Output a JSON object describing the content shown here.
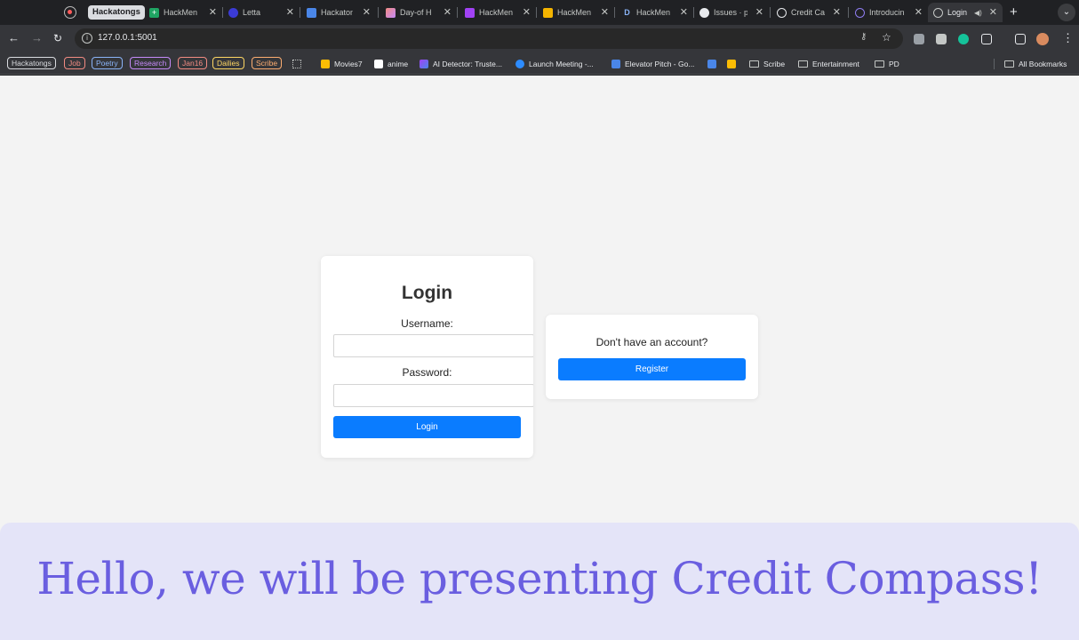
{
  "tabs": {
    "group_label": "Hackatongs",
    "items": [
      {
        "label": "HackMen",
        "icon": "sheets-icon"
      },
      {
        "label": "Letta",
        "icon": "letta-icon"
      },
      {
        "label": "Hackaton",
        "icon": "docs-icon"
      },
      {
        "label": "Day-of H",
        "icon": "wand-icon"
      },
      {
        "label": "HackMen",
        "icon": "hackmen-icon"
      },
      {
        "label": "HackMen",
        "icon": "slides-icon"
      },
      {
        "label": "HackMen",
        "icon": "d-icon"
      },
      {
        "label": "Issues · p",
        "icon": "github-icon"
      },
      {
        "label": "Credit Ca",
        "icon": "openai-icon"
      },
      {
        "label": "Introducin",
        "icon": "react-icon"
      },
      {
        "label": "Login",
        "icon": "globe-icon"
      }
    ]
  },
  "toolbar": {
    "url": "127.0.0.1:5001"
  },
  "bookmarks": {
    "chips": [
      {
        "label": "Hackatongs",
        "color": "#dadce0"
      },
      {
        "label": "Job",
        "color": "#f28b82"
      },
      {
        "label": "Poetry",
        "color": "#8ab4f8"
      },
      {
        "label": "Research",
        "color": "#c58af9"
      },
      {
        "label": "Jan16",
        "color": "#f28b82"
      },
      {
        "label": "Dailies",
        "color": "#fdd663"
      },
      {
        "label": "Scribe",
        "color": "#fcad70"
      }
    ],
    "items": [
      {
        "label": "Movies7",
        "icon": "play-icon"
      },
      {
        "label": "anime",
        "icon": "page-icon"
      },
      {
        "label": "AI Detector: Truste...",
        "icon": "ai-detector-icon"
      },
      {
        "label": "Launch Meeting -...",
        "icon": "zoom-icon"
      },
      {
        "label": "Elevator Pitch - Go...",
        "icon": "docs-icon"
      }
    ],
    "folders": [
      "Scribe",
      "Entertainment",
      "PD"
    ],
    "all_bookmarks": "All Bookmarks"
  },
  "login": {
    "title": "Login",
    "username_label": "Username:",
    "password_label": "Password:",
    "button": "Login"
  },
  "register": {
    "prompt": "Don't have an account?",
    "button": "Register"
  },
  "caption": {
    "text": "Hello, we will be presenting Credit Compass!"
  },
  "colors": {
    "accent": "#0a7cff",
    "caption_text": "#6a5ee0",
    "caption_bg": "#e4e4f8",
    "page_bg": "#f3f3f3"
  }
}
